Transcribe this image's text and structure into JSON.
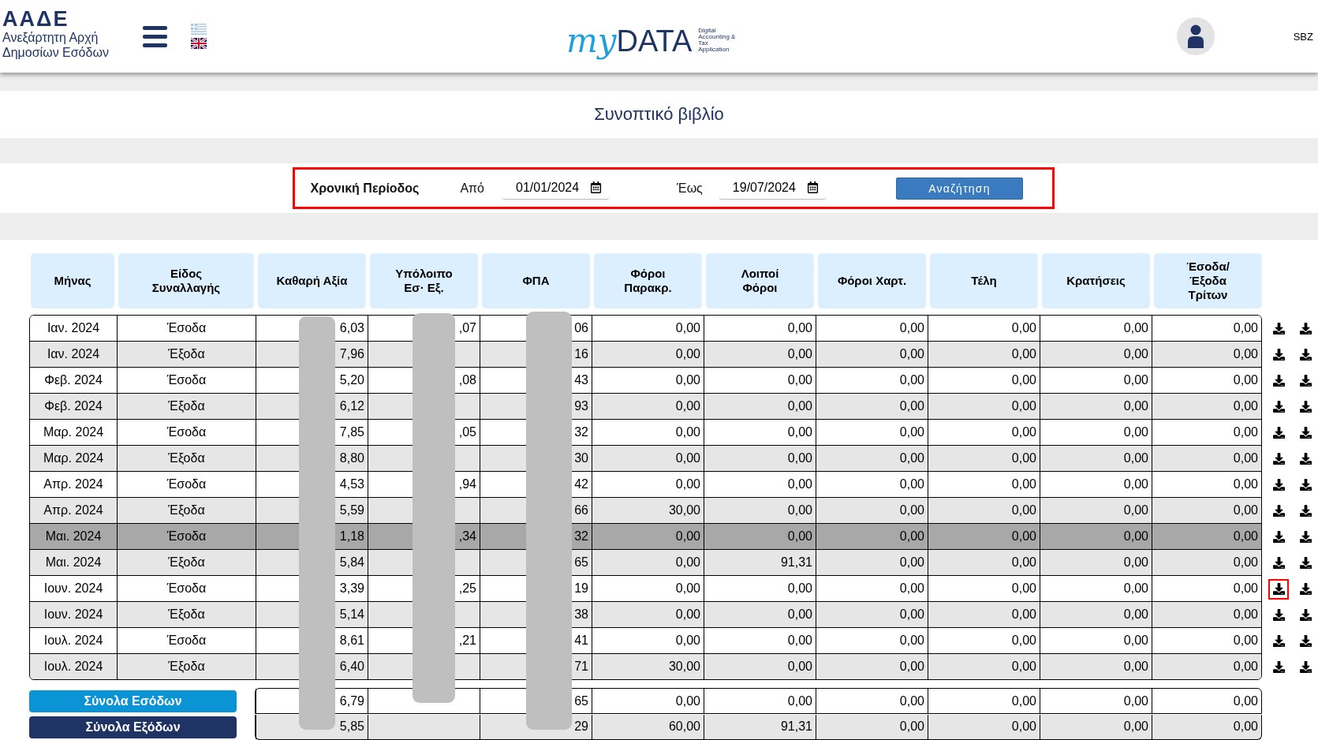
{
  "header": {
    "logo": {
      "acronym": "ΑΑΔΕ",
      "line_1": "Ανεξάρτητη Αρχή",
      "line_2": "Δημοσίων Εσόδων"
    },
    "languages": [
      {
        "kind": "greek",
        "selected": false
      },
      {
        "kind": "uk",
        "selected": true
      }
    ],
    "app_logo": {
      "script": "my",
      "word": "DATA",
      "tagline": [
        "Digital",
        "Accounting &",
        "Tax",
        "Application"
      ]
    },
    "user": "SBZ"
  },
  "title": "Συνοπτικό βιβλίο",
  "filter": {
    "highlighted": true,
    "label": "Χρονική Περίοδος",
    "from_label": "Από",
    "from_value": "01/01/2024",
    "to_label": "Έως",
    "to_value": "19/07/2024",
    "button": "Αναζήτηση"
  },
  "table": {
    "columns": [
      "Μήνας",
      "Είδος Συναλλαγής",
      "Καθαρή Αξία",
      "Υπόλοιπο Εσ· Εξ.",
      "ΦΠΑ",
      "Φόροι Παρακρ.",
      "Λοιποί Φόροι",
      "Φόροι Χαρτ.",
      "Τέλη",
      "Κρατήσεις",
      "Έσοδα/ Έξοδα Τρίτων"
    ],
    "rows": [
      {
        "month": "Ιαν. 2024",
        "type": "Έσοδα",
        "net": "6,03",
        "balance": ",07",
        "vat": "06",
        "amounts": [
          "0,00",
          "0,00",
          "0,00",
          "0,00",
          "0,00",
          "0,00"
        ],
        "selected": false,
        "download_marked": false
      },
      {
        "month": "Ιαν. 2024",
        "type": "Έξοδα",
        "net": "7,96",
        "vat": "16",
        "amounts": [
          "0,00",
          "0,00",
          "0,00",
          "0,00",
          "0,00",
          "0,00"
        ],
        "selected": false,
        "download_marked": false
      },
      {
        "month": "Φεβ. 2024",
        "type": "Έσοδα",
        "net": "5,20",
        "balance": ",08",
        "vat": "43",
        "amounts": [
          "0,00",
          "0,00",
          "0,00",
          "0,00",
          "0,00",
          "0,00"
        ],
        "selected": false,
        "download_marked": false
      },
      {
        "month": "Φεβ. 2024",
        "type": "Έξοδα",
        "net": "6,12",
        "vat": "93",
        "amounts": [
          "0,00",
          "0,00",
          "0,00",
          "0,00",
          "0,00",
          "0,00"
        ],
        "selected": false,
        "download_marked": false
      },
      {
        "month": "Μαρ. 2024",
        "type": "Έσοδα",
        "net": "7,85",
        "balance": ",05",
        "vat": "32",
        "amounts": [
          "0,00",
          "0,00",
          "0,00",
          "0,00",
          "0,00",
          "0,00"
        ],
        "selected": false,
        "download_marked": false
      },
      {
        "month": "Μαρ. 2024",
        "type": "Έξοδα",
        "net": "8,80",
        "vat": "30",
        "amounts": [
          "0,00",
          "0,00",
          "0,00",
          "0,00",
          "0,00",
          "0,00"
        ],
        "selected": false,
        "download_marked": false
      },
      {
        "month": "Απρ. 2024",
        "type": "Έσοδα",
        "net": "4,53",
        "balance": ",94",
        "vat": "42",
        "amounts": [
          "0,00",
          "0,00",
          "0,00",
          "0,00",
          "0,00",
          "0,00"
        ],
        "selected": false,
        "download_marked": false
      },
      {
        "month": "Απρ. 2024",
        "type": "Έξοδα",
        "net": "5,59",
        "vat": "66",
        "amounts": [
          "30,00",
          "0,00",
          "0,00",
          "0,00",
          "0,00",
          "0,00"
        ],
        "selected": false,
        "download_marked": false
      },
      {
        "month": "Μαι. 2024",
        "type": "Έσοδα",
        "net": "1,18",
        "balance": ",34",
        "vat": "32",
        "amounts": [
          "0,00",
          "0,00",
          "0,00",
          "0,00",
          "0,00",
          "0,00"
        ],
        "selected": true,
        "download_marked": false
      },
      {
        "month": "Μαι. 2024",
        "type": "Έξοδα",
        "net": "5,84",
        "vat": "65",
        "amounts": [
          "0,00",
          "91,31",
          "0,00",
          "0,00",
          "0,00",
          "0,00"
        ],
        "selected": false,
        "download_marked": false
      },
      {
        "month": "Ιουν. 2024",
        "type": "Έσοδα",
        "net": "3,39",
        "balance": ",25",
        "vat": "19",
        "amounts": [
          "0,00",
          "0,00",
          "0,00",
          "0,00",
          "0,00",
          "0,00"
        ],
        "selected": false,
        "download_marked": true
      },
      {
        "month": "Ιουν. 2024",
        "type": "Έξοδα",
        "net": "5,14",
        "vat": "38",
        "amounts": [
          "0,00",
          "0,00",
          "0,00",
          "0,00",
          "0,00",
          "0,00"
        ],
        "selected": false,
        "download_marked": false
      },
      {
        "month": "Ιουλ. 2024",
        "type": "Έσοδα",
        "net": "8,61",
        "balance": ",21",
        "vat": "41",
        "amounts": [
          "0,00",
          "0,00",
          "0,00",
          "0,00",
          "0,00",
          "0,00"
        ],
        "selected": false,
        "download_marked": false
      },
      {
        "month": "Ιουλ. 2024",
        "type": "Έξοδα",
        "net": "6,40",
        "vat": "71",
        "amounts": [
          "30,00",
          "0,00",
          "0,00",
          "0,00",
          "0,00",
          "0,00"
        ],
        "selected": false,
        "download_marked": false
      }
    ],
    "totals": [
      {
        "kind": "income",
        "label": "Σύνολα Εσόδων",
        "net": "6,79",
        "vat": "65",
        "amounts": [
          "0,00",
          "0,00",
          "0,00",
          "0,00",
          "0,00",
          "0,00"
        ]
      },
      {
        "kind": "expense",
        "label": "Σύνολα Εξόδων",
        "net": "5,85",
        "vat": "29",
        "amounts": [
          "60,00",
          "91,31",
          "0,00",
          "0,00",
          "0,00",
          "0,00"
        ]
      }
    ]
  }
}
